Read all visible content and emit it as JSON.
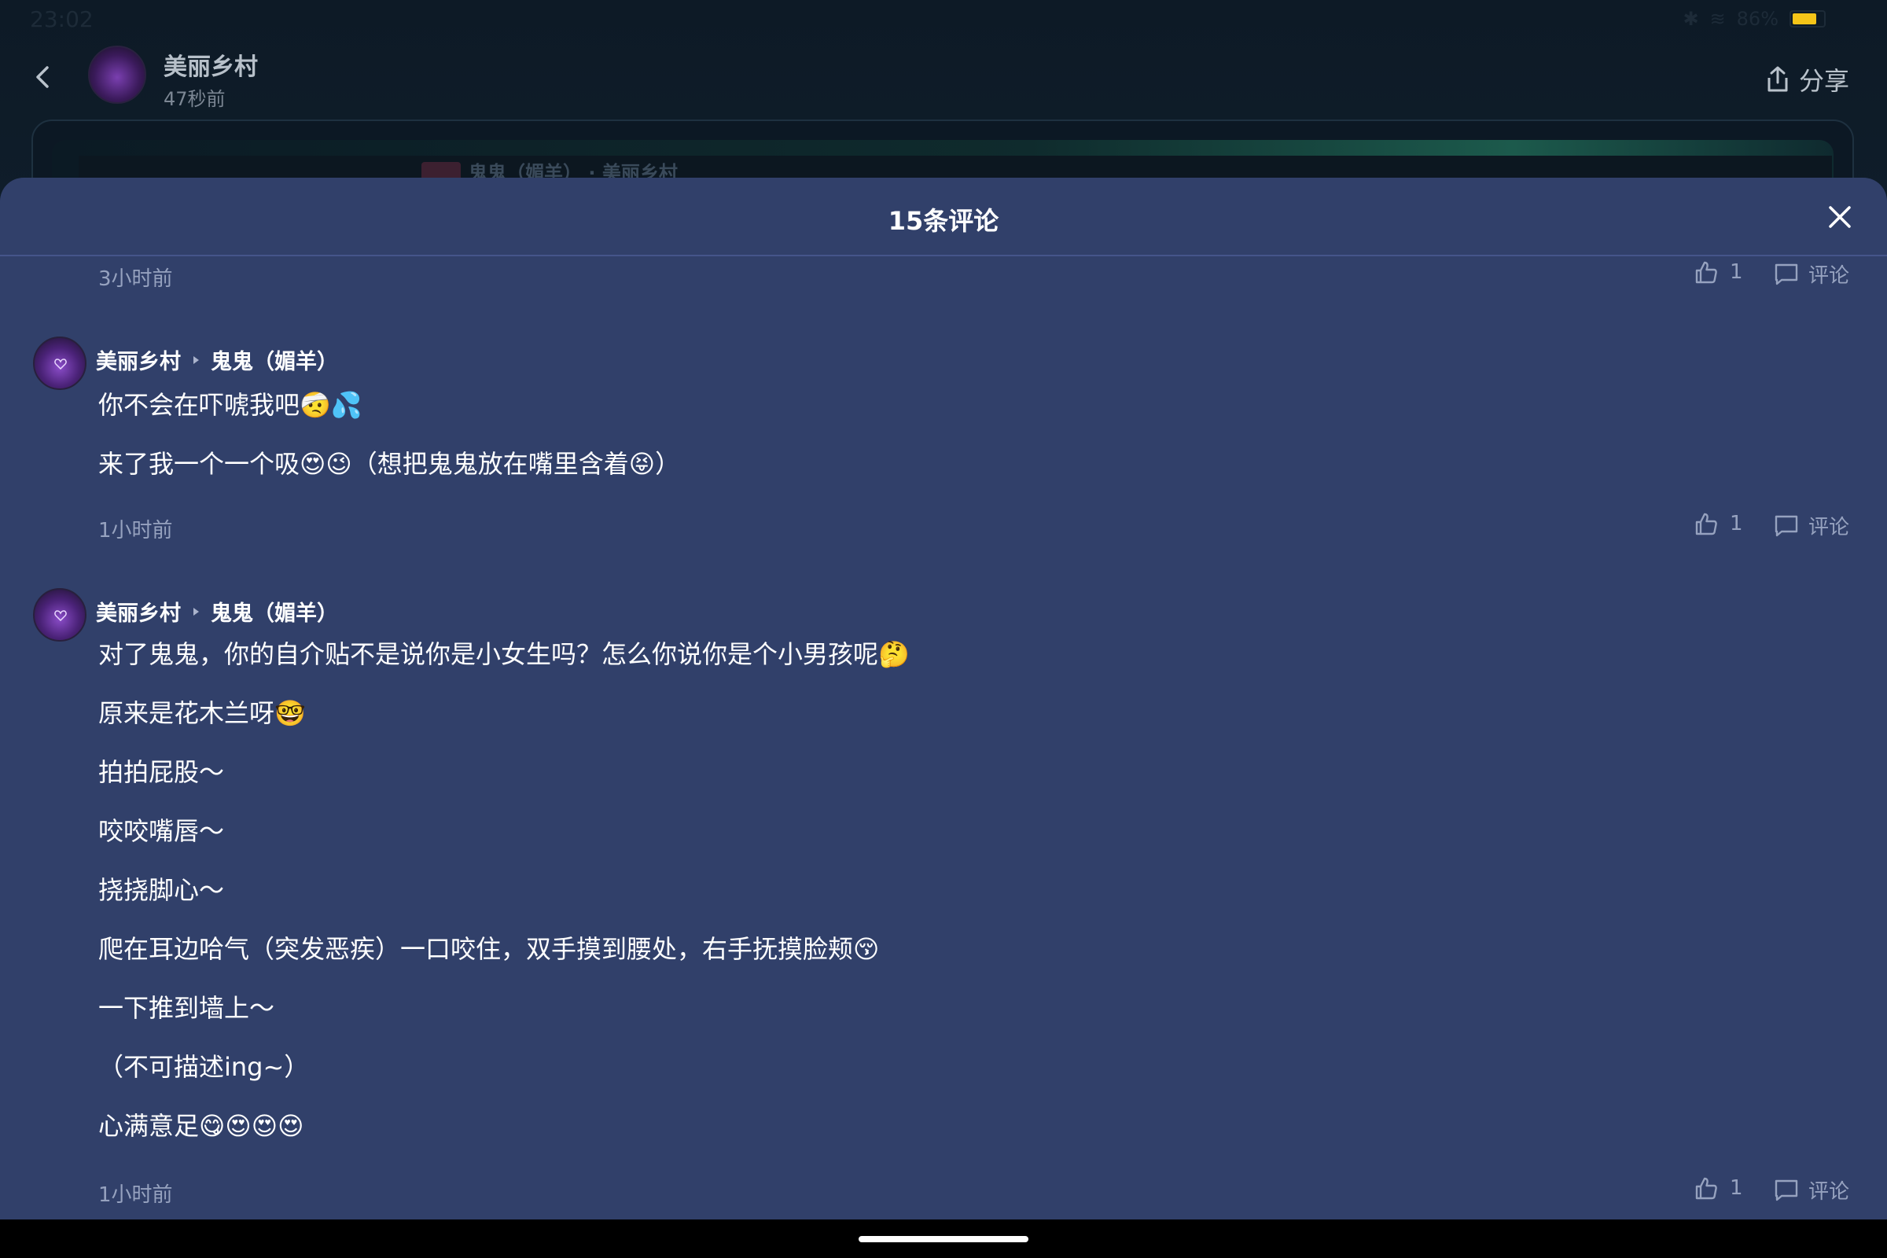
{
  "status_bar": {
    "time": "23:02",
    "battery_percent": "86%",
    "bluetooth": "✱",
    "wifi": "≋"
  },
  "post": {
    "author": "美丽乡村",
    "time": "47秒前",
    "share_label": "分享",
    "card_text": "鬼鬼（媚羊） · 美丽乡村"
  },
  "sheet": {
    "title": "15条评论"
  },
  "top_meta": {
    "time": "3小时前",
    "likes": "1",
    "reply_label": "评论"
  },
  "comments": [
    {
      "author": "美丽乡村",
      "reply_to": "鬼鬼（媚羊）",
      "lines": [
        "你不会在吓唬我吧🤕💦",
        "来了我一个一个吸😍😉（想把鬼鬼放在嘴里含着😝）"
      ],
      "time": "1小时前",
      "likes": "1",
      "reply_label": "评论"
    },
    {
      "author": "美丽乡村",
      "reply_to": "鬼鬼（媚羊）",
      "lines": [
        "对了鬼鬼，你的自介贴不是说你是小女生吗？怎么你说你是个小男孩呢🤔",
        "原来是花木兰呀🤓",
        "拍拍屁股～",
        "咬咬嘴唇～",
        "挠挠脚心～",
        "爬在耳边哈气（突发恶疾）一口咬住，双手摸到腰处，右手抚摸脸颊😚",
        "一下推到墙上～",
        "（不可描述ing~）",
        "心满意足😋😍😍😍"
      ],
      "time": "1小时前",
      "likes": "1",
      "reply_label": "评论"
    }
  ],
  "icons": {
    "back": "chevron-left-icon",
    "share": "share-icon",
    "close": "close-icon",
    "like": "thumbs-up-icon",
    "reply": "comment-icon"
  }
}
